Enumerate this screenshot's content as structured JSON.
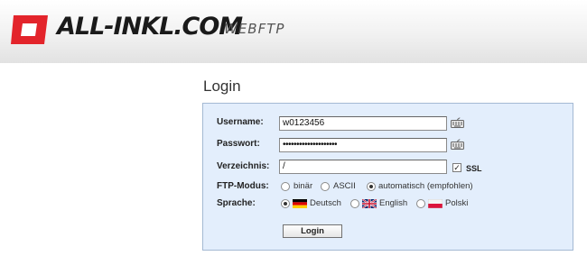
{
  "header": {
    "logo_text": "ALL-INKL.COM",
    "logo_sub": "WEBFTP",
    "brand_color": "#e3242b"
  },
  "page": {
    "title": "Login"
  },
  "form": {
    "username_label": "Username:",
    "username_value": "w0123456",
    "password_label": "Passwort:",
    "password_value": "••••••••••••••••••••",
    "directory_label": "Verzeichnis:",
    "directory_value": "/",
    "ssl_label": "SSL",
    "ssl_checked": true,
    "ftp_mode_label": "FTP-Modus:",
    "ftp_modes": [
      {
        "label": "binär",
        "selected": false
      },
      {
        "label": "ASCII",
        "selected": false
      },
      {
        "label": "automatisch (empfohlen)",
        "selected": true
      }
    ],
    "language_label": "Sprache:",
    "languages": [
      {
        "label": "Deutsch",
        "flag": "de-flag-icon",
        "selected": true
      },
      {
        "label": "English",
        "flag": "uk-flag-icon",
        "selected": false
      },
      {
        "label": "Polski",
        "flag": "pl-flag-icon",
        "selected": false
      }
    ],
    "login_button": "Login",
    "keyboard_icon": "virtual-keyboard-icon"
  }
}
